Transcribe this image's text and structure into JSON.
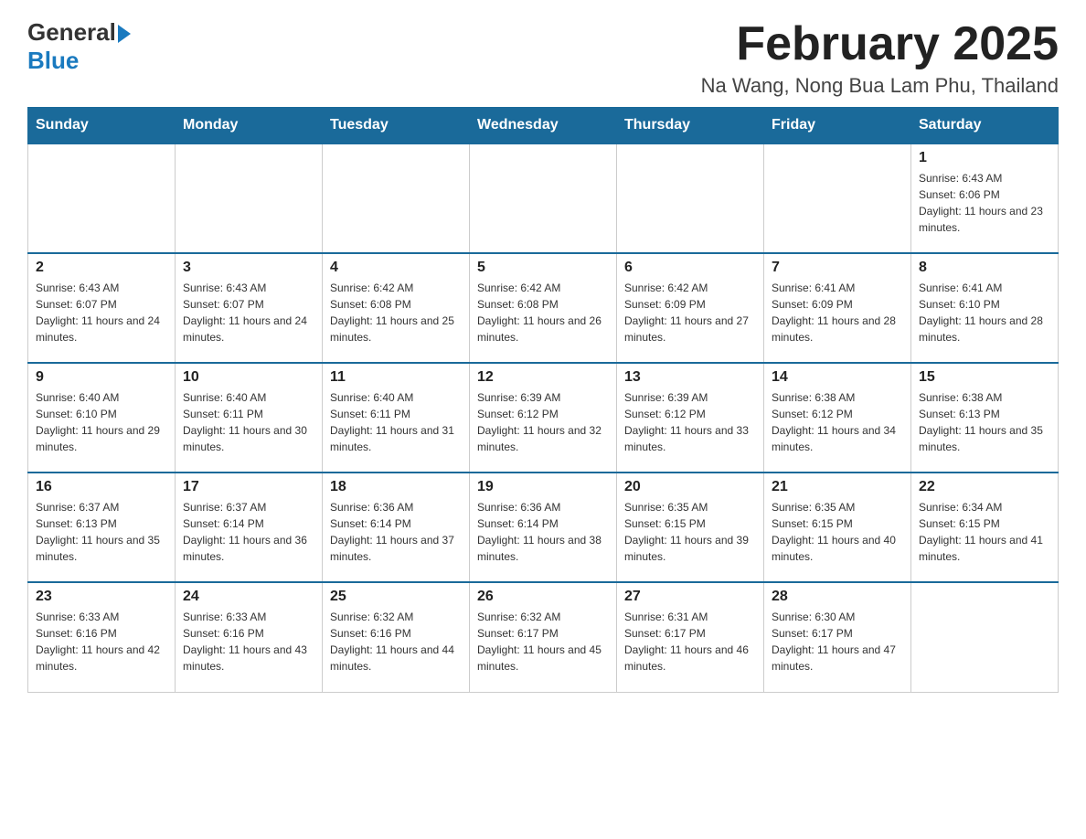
{
  "header": {
    "logo_general": "General",
    "logo_blue": "Blue",
    "month_title": "February 2025",
    "location": "Na Wang, Nong Bua Lam Phu, Thailand"
  },
  "weekdays": [
    "Sunday",
    "Monday",
    "Tuesday",
    "Wednesday",
    "Thursday",
    "Friday",
    "Saturday"
  ],
  "weeks": [
    [
      {
        "day": "",
        "info": ""
      },
      {
        "day": "",
        "info": ""
      },
      {
        "day": "",
        "info": ""
      },
      {
        "day": "",
        "info": ""
      },
      {
        "day": "",
        "info": ""
      },
      {
        "day": "",
        "info": ""
      },
      {
        "day": "1",
        "info": "Sunrise: 6:43 AM\nSunset: 6:06 PM\nDaylight: 11 hours and 23 minutes."
      }
    ],
    [
      {
        "day": "2",
        "info": "Sunrise: 6:43 AM\nSunset: 6:07 PM\nDaylight: 11 hours and 24 minutes."
      },
      {
        "day": "3",
        "info": "Sunrise: 6:43 AM\nSunset: 6:07 PM\nDaylight: 11 hours and 24 minutes."
      },
      {
        "day": "4",
        "info": "Sunrise: 6:42 AM\nSunset: 6:08 PM\nDaylight: 11 hours and 25 minutes."
      },
      {
        "day": "5",
        "info": "Sunrise: 6:42 AM\nSunset: 6:08 PM\nDaylight: 11 hours and 26 minutes."
      },
      {
        "day": "6",
        "info": "Sunrise: 6:42 AM\nSunset: 6:09 PM\nDaylight: 11 hours and 27 minutes."
      },
      {
        "day": "7",
        "info": "Sunrise: 6:41 AM\nSunset: 6:09 PM\nDaylight: 11 hours and 28 minutes."
      },
      {
        "day": "8",
        "info": "Sunrise: 6:41 AM\nSunset: 6:10 PM\nDaylight: 11 hours and 28 minutes."
      }
    ],
    [
      {
        "day": "9",
        "info": "Sunrise: 6:40 AM\nSunset: 6:10 PM\nDaylight: 11 hours and 29 minutes."
      },
      {
        "day": "10",
        "info": "Sunrise: 6:40 AM\nSunset: 6:11 PM\nDaylight: 11 hours and 30 minutes."
      },
      {
        "day": "11",
        "info": "Sunrise: 6:40 AM\nSunset: 6:11 PM\nDaylight: 11 hours and 31 minutes."
      },
      {
        "day": "12",
        "info": "Sunrise: 6:39 AM\nSunset: 6:12 PM\nDaylight: 11 hours and 32 minutes."
      },
      {
        "day": "13",
        "info": "Sunrise: 6:39 AM\nSunset: 6:12 PM\nDaylight: 11 hours and 33 minutes."
      },
      {
        "day": "14",
        "info": "Sunrise: 6:38 AM\nSunset: 6:12 PM\nDaylight: 11 hours and 34 minutes."
      },
      {
        "day": "15",
        "info": "Sunrise: 6:38 AM\nSunset: 6:13 PM\nDaylight: 11 hours and 35 minutes."
      }
    ],
    [
      {
        "day": "16",
        "info": "Sunrise: 6:37 AM\nSunset: 6:13 PM\nDaylight: 11 hours and 35 minutes."
      },
      {
        "day": "17",
        "info": "Sunrise: 6:37 AM\nSunset: 6:14 PM\nDaylight: 11 hours and 36 minutes."
      },
      {
        "day": "18",
        "info": "Sunrise: 6:36 AM\nSunset: 6:14 PM\nDaylight: 11 hours and 37 minutes."
      },
      {
        "day": "19",
        "info": "Sunrise: 6:36 AM\nSunset: 6:14 PM\nDaylight: 11 hours and 38 minutes."
      },
      {
        "day": "20",
        "info": "Sunrise: 6:35 AM\nSunset: 6:15 PM\nDaylight: 11 hours and 39 minutes."
      },
      {
        "day": "21",
        "info": "Sunrise: 6:35 AM\nSunset: 6:15 PM\nDaylight: 11 hours and 40 minutes."
      },
      {
        "day": "22",
        "info": "Sunrise: 6:34 AM\nSunset: 6:15 PM\nDaylight: 11 hours and 41 minutes."
      }
    ],
    [
      {
        "day": "23",
        "info": "Sunrise: 6:33 AM\nSunset: 6:16 PM\nDaylight: 11 hours and 42 minutes."
      },
      {
        "day": "24",
        "info": "Sunrise: 6:33 AM\nSunset: 6:16 PM\nDaylight: 11 hours and 43 minutes."
      },
      {
        "day": "25",
        "info": "Sunrise: 6:32 AM\nSunset: 6:16 PM\nDaylight: 11 hours and 44 minutes."
      },
      {
        "day": "26",
        "info": "Sunrise: 6:32 AM\nSunset: 6:17 PM\nDaylight: 11 hours and 45 minutes."
      },
      {
        "day": "27",
        "info": "Sunrise: 6:31 AM\nSunset: 6:17 PM\nDaylight: 11 hours and 46 minutes."
      },
      {
        "day": "28",
        "info": "Sunrise: 6:30 AM\nSunset: 6:17 PM\nDaylight: 11 hours and 47 minutes."
      },
      {
        "day": "",
        "info": ""
      }
    ]
  ]
}
